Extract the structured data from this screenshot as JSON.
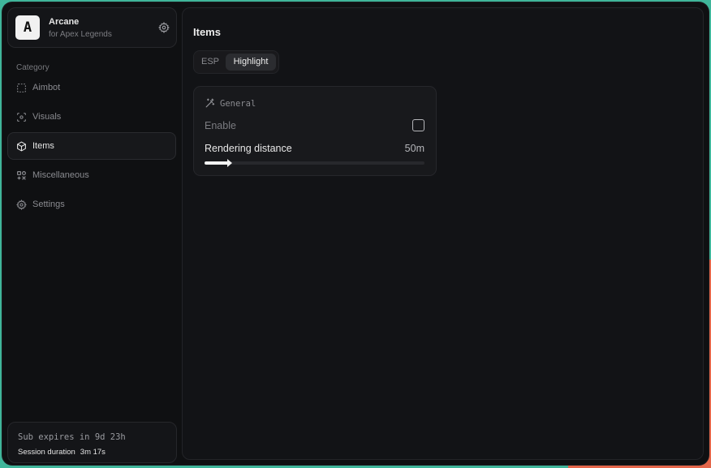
{
  "app": {
    "name": "Arcane",
    "subtitle": "for Apex Legends",
    "logo_letter": "A"
  },
  "sidebar": {
    "category_label": "Category",
    "items": [
      {
        "label": "Aimbot",
        "icon": "scan-dashed-icon",
        "active": false
      },
      {
        "label": "Visuals",
        "icon": "scan-eye-icon",
        "active": false
      },
      {
        "label": "Items",
        "icon": "box-icon",
        "active": true
      },
      {
        "label": "Miscellaneous",
        "icon": "grid-tools-icon",
        "active": false
      },
      {
        "label": "Settings",
        "icon": "gear-icon",
        "active": false
      }
    ],
    "footer": {
      "subscription": "Sub expires in 9d 23h",
      "session_label": "Session duration",
      "session_value": "3m 17s"
    }
  },
  "main": {
    "title": "Items",
    "tabs": [
      {
        "label": "ESP",
        "active": false
      },
      {
        "label": "Highlight",
        "active": true
      }
    ],
    "card": {
      "title": "General",
      "icon": "magic-wand-icon",
      "enable_label": "Enable",
      "enable_checked": false,
      "rendering_label": "Rendering distance",
      "rendering_value": "50m",
      "rendering_fraction": 0.11
    }
  },
  "colors": {
    "background": "#0f1012",
    "accent": "#f2f2f2",
    "muted_text": "#8a8b90"
  }
}
